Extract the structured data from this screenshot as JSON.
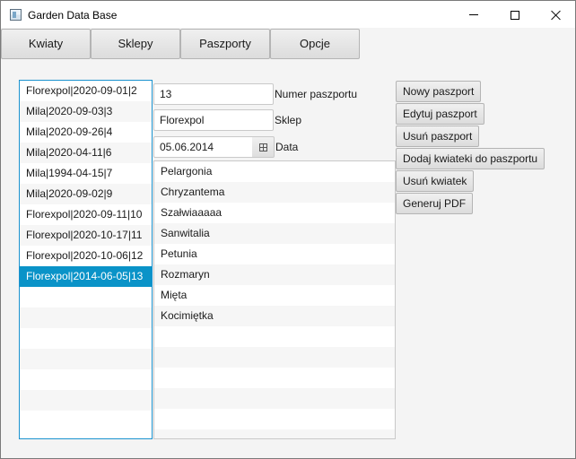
{
  "window": {
    "title": "Garden Data Base"
  },
  "nav": {
    "kwiaty": "Kwiaty",
    "sklepy": "Sklepy",
    "paszporty": "Paszporty",
    "opcje": "Opcje"
  },
  "passports": [
    "Florexpol|2020-09-01|2",
    "Mila|2020-09-03|3",
    "Mila|2020-09-26|4",
    "Mila|2020-04-11|6",
    "Mila|1994-04-15|7",
    "Mila|2020-09-02|9",
    "Florexpol|2020-09-11|10",
    "Florexpol|2020-10-17|11",
    "Florexpol|2020-10-06|12",
    "Florexpol|2014-06-05|13"
  ],
  "selected_passport_index": 9,
  "form": {
    "number_value": "13",
    "number_label": "Numer paszportu",
    "shop_value": "Florexpol",
    "shop_label": "Sklep",
    "date_value": "05.06.2014",
    "date_label": "Data"
  },
  "flowers": [
    "Pelargonia",
    "Chryzantema",
    "Szałwiaaaaa",
    "Sanwitalia",
    "Petunia",
    "Rozmaryn",
    "Mięta",
    "Kocimiętka"
  ],
  "actions": {
    "new_passport": "Nowy paszport",
    "edit_passport": "Edytuj paszport",
    "delete_passport": "Usuń paszport",
    "add_flowers": "Dodaj kwiateki do paszportu",
    "delete_flower": "Usuń kwiatek",
    "generate_pdf": "Generuj PDF"
  },
  "colors": {
    "selection": "#0a93c8",
    "focus_border": "#1b93cf"
  }
}
